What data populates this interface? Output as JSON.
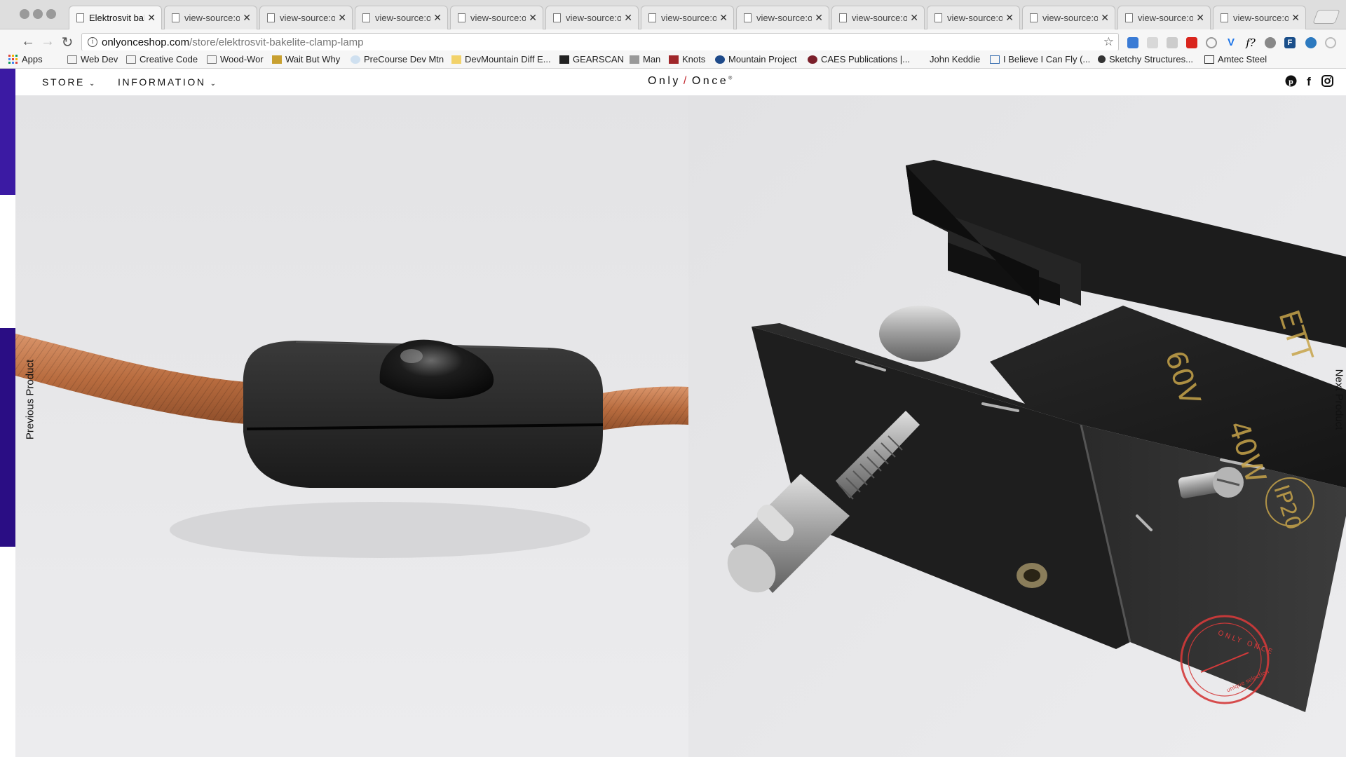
{
  "browser": {
    "tabs": [
      {
        "title": "Elektrosvit bakelite",
        "active": true
      },
      {
        "title": "view-source:o"
      },
      {
        "title": "view-source:o"
      },
      {
        "title": "view-source:o"
      },
      {
        "title": "view-source:o"
      },
      {
        "title": "view-source:o"
      },
      {
        "title": "view-source:o"
      },
      {
        "title": "view-source:o"
      },
      {
        "title": "view-source:o"
      },
      {
        "title": "view-source:o"
      },
      {
        "title": "view-source:o"
      },
      {
        "title": "view-source:o"
      },
      {
        "title": "view-source:o"
      }
    ],
    "address": {
      "host": "onlyonceshop.com",
      "path": "/store/elektrosvit-bakelite-clamp-lamp"
    },
    "bookmarks": [
      {
        "label": "Apps",
        "icon": "apps-icon"
      },
      {
        "label": "Web Dev",
        "icon": "folder-icon"
      },
      {
        "label": "Creative Code",
        "icon": "folder-icon"
      },
      {
        "label": "Wood-Wor",
        "icon": "folder-icon"
      },
      {
        "label": "Wait But Why",
        "icon": "site-icon"
      },
      {
        "label": "PreCourse Dev Mtn",
        "icon": "site-icon"
      },
      {
        "label": "DevMountain Diff E...",
        "icon": "site-icon"
      },
      {
        "label": "GEARSCAN",
        "icon": "site-icon"
      },
      {
        "label": "Man",
        "icon": "site-icon"
      },
      {
        "label": "Knots",
        "icon": "site-icon"
      },
      {
        "label": "Mountain Project",
        "icon": "site-icon"
      },
      {
        "label": "CAES Publications |...",
        "icon": "site-icon"
      },
      {
        "label": "John Keddie",
        "icon": "none"
      },
      {
        "label": "I Believe I Can Fly (...",
        "icon": "site-icon"
      },
      {
        "label": "Sketchy Structures...",
        "icon": "site-icon"
      },
      {
        "label": "Amtec Steel",
        "icon": "site-icon"
      }
    ]
  },
  "site": {
    "nav": {
      "store": "STORE",
      "information": "INFORMATION",
      "chevron": "⌄"
    },
    "logo": {
      "only": "Only",
      "slash": "/",
      "once": "Once",
      "mark": "®"
    },
    "social": [
      "pinterest-icon",
      "facebook-icon",
      "instagram-icon"
    ],
    "previous": "Previous Product",
    "next": "Next Product",
    "stamp": {
      "top": "ONLY ONCE",
      "bottom": "unique selection"
    },
    "clamp_markings": {
      "brand": "ETT",
      "voltage": "60V",
      "wattage": "40W",
      "rating": "IP20"
    },
    "colors": {
      "accent": "#c1272d",
      "sidebar": "#2a0d84",
      "cable": "#c27a4a"
    }
  }
}
